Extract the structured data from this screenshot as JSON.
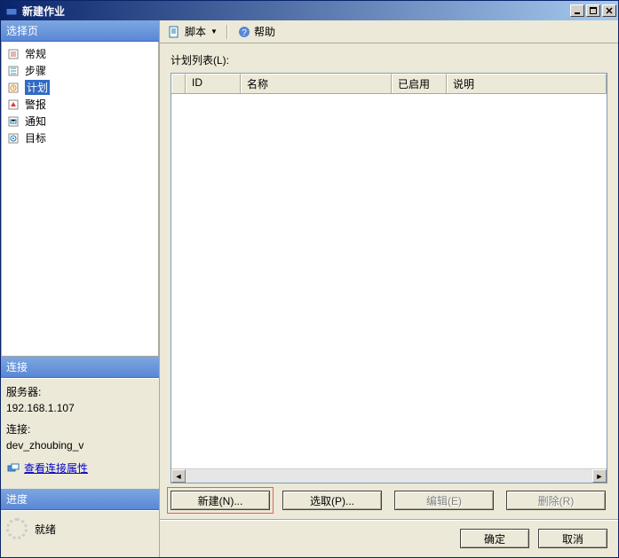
{
  "titlebar": {
    "title": "新建作业"
  },
  "sidebar": {
    "select_page_header": "选择页",
    "pages": [
      {
        "label": "常规",
        "icon": "gear-icon"
      },
      {
        "label": "步骤",
        "icon": "steps-icon"
      },
      {
        "label": "计划",
        "icon": "schedule-icon",
        "selected": true
      },
      {
        "label": "警报",
        "icon": "alert-icon"
      },
      {
        "label": "通知",
        "icon": "notify-icon"
      },
      {
        "label": "目标",
        "icon": "target-icon"
      }
    ],
    "connection_header": "连接",
    "server_label": "服务器:",
    "server_value": "192.168.1.107",
    "connection_label": "连接:",
    "connection_value": "dev_zhoubing_v",
    "view_props_link": "查看连接属性",
    "progress_header": "进度",
    "progress_status": "就绪"
  },
  "toolbar": {
    "script_label": "脚本",
    "help_label": "帮助"
  },
  "main": {
    "list_label": "计划列表(L):",
    "columns": {
      "id": "ID",
      "name": "名称",
      "enabled": "已启用",
      "description": "说明"
    },
    "buttons": {
      "new": "新建(N)...",
      "pick": "选取(P)...",
      "edit": "编辑(E)",
      "delete": "删除(R)"
    }
  },
  "footer": {
    "ok": "确定",
    "cancel": "取消"
  }
}
